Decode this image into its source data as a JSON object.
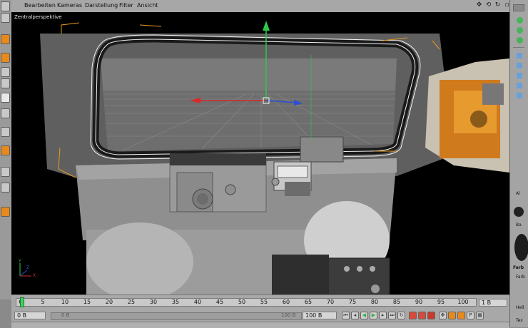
{
  "menubar": {
    "items": [
      "Bearbeiten",
      "Kameras",
      "Darstellung",
      "Filter",
      "Ansicht"
    ]
  },
  "viewport": {
    "label": "Zentralperspektive",
    "axis_labels": {
      "y": "Y",
      "x": "X",
      "z": "Z"
    }
  },
  "timeline": {
    "ticks": [
      "0",
      "5",
      "10",
      "15",
      "20",
      "25",
      "30",
      "35",
      "40",
      "45",
      "50",
      "55",
      "60",
      "65",
      "70",
      "75",
      "80",
      "85",
      "90",
      "95",
      "100"
    ],
    "current_frame": "1 B"
  },
  "transport": {
    "start_field": "0 B",
    "range_start": "0 B",
    "range_end": "100 B",
    "end_field": "100 B"
  },
  "right_panel": {
    "labels": [
      "Al",
      "Ba",
      "Farb",
      "Farb",
      "Hell",
      "Tex"
    ]
  },
  "colors": {
    "accent": "#e8891c",
    "axis_y": "#2fc84a",
    "axis_x": "#d62a2a",
    "axis_z": "#2a4ed6",
    "selection": "#e79a1e"
  }
}
